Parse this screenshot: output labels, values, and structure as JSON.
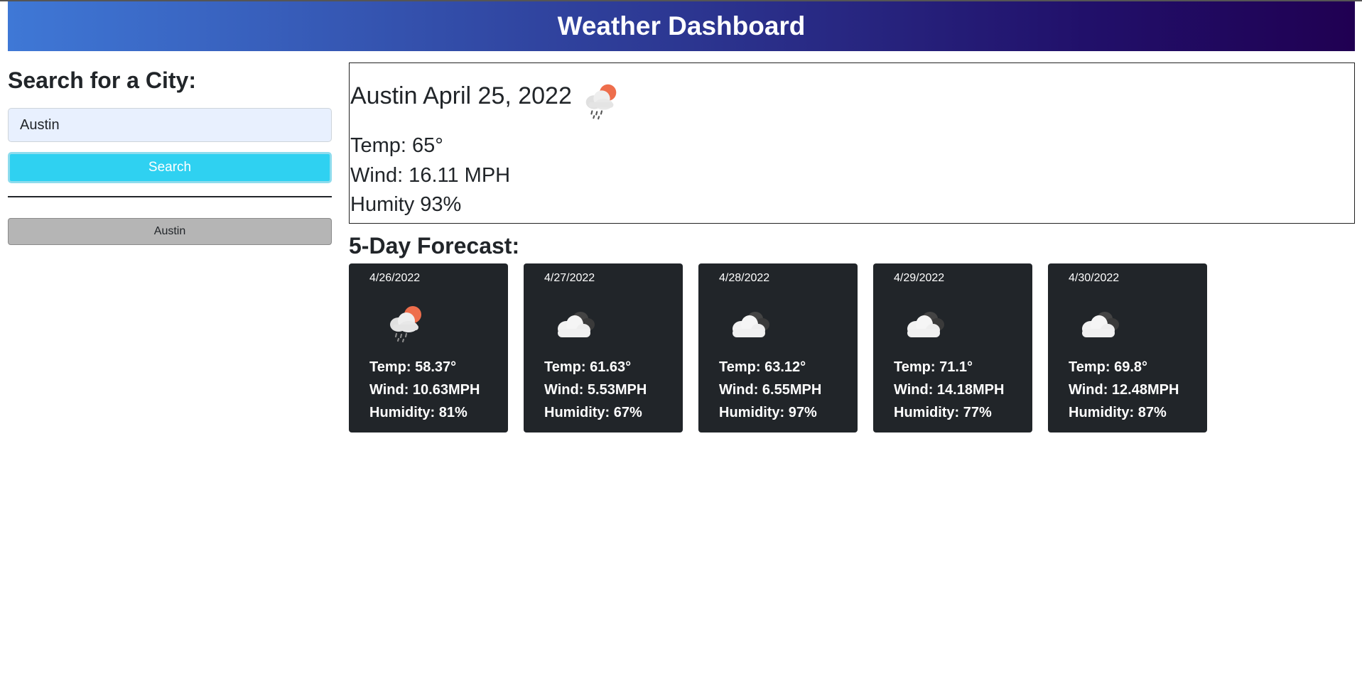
{
  "header": {
    "title": "Weather Dashboard",
    "colors": {
      "start": "#3f78d6",
      "end": "#200052"
    }
  },
  "sidebar": {
    "heading": "Search for a City:",
    "search_input_value": "Austin",
    "search_button_label": "Search",
    "history": [
      "Austin"
    ]
  },
  "current": {
    "title": "Austin April 25, 2022",
    "icon": "rain-cloud-sun-icon",
    "temp": "Temp: 65°",
    "wind": "Wind: 16.11 MPH",
    "humidity": "Humity 93%"
  },
  "forecast": {
    "heading": "5-Day Forecast:",
    "days": [
      {
        "date": "4/26/2022",
        "icon": "rain-cloud-sun-icon",
        "temp": "Temp: 58.37°",
        "wind": "Wind: 10.63MPH",
        "humidity": "Humidity: 81%"
      },
      {
        "date": "4/27/2022",
        "icon": "broken-clouds-icon",
        "temp": "Temp: 61.63°",
        "wind": "Wind: 5.53MPH",
        "humidity": "Humidity: 67%"
      },
      {
        "date": "4/28/2022",
        "icon": "broken-clouds-icon",
        "temp": "Temp: 63.12°",
        "wind": "Wind: 6.55MPH",
        "humidity": "Humidity: 97%"
      },
      {
        "date": "4/29/2022",
        "icon": "broken-clouds-icon",
        "temp": "Temp: 71.1°",
        "wind": "Wind: 14.18MPH",
        "humidity": "Humidity: 77%"
      },
      {
        "date": "4/30/2022",
        "icon": "broken-clouds-icon",
        "temp": "Temp: 69.8°",
        "wind": "Wind: 12.48MPH",
        "humidity": "Humidity: 87%"
      }
    ]
  },
  "colors": {
    "search_button": "#2fd1f1",
    "card_bg": "#212529",
    "history_button": "#b5b5b5",
    "sun": "#ee6e4c"
  }
}
